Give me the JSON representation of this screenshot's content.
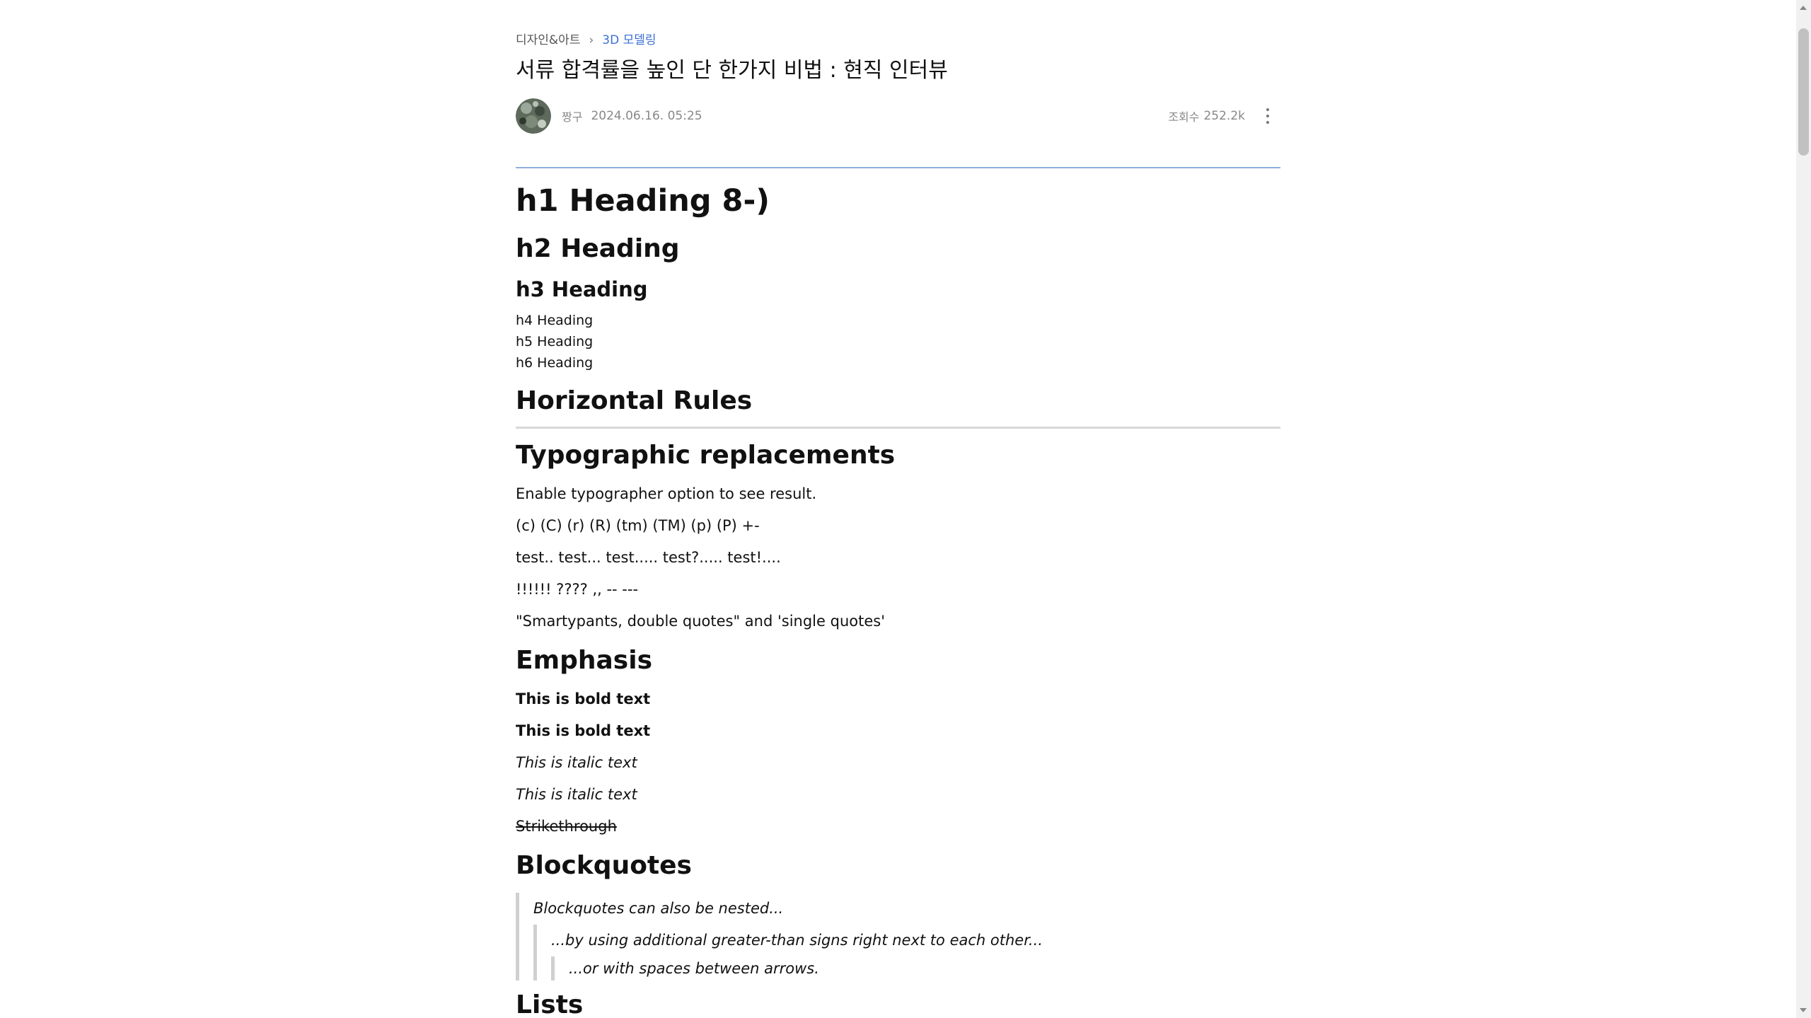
{
  "breadcrumb": {
    "category": "디자인&아트",
    "separator_icon": "chevron-right-icon",
    "subcategory": "3D 모델링"
  },
  "post": {
    "title": "서류 합격률을 높인 단 한가지 비법 : 현직 인터뷰",
    "author": "짱구",
    "date": "2024.06.16. 05:25",
    "views_label": "조회수",
    "views_value": "252.2k",
    "more_icon": "kebab-menu-icon"
  },
  "markdown": {
    "h1": "h1 Heading 8-)",
    "h2": "h2 Heading",
    "h3": "h3 Heading",
    "h4": "h4 Heading",
    "h5": "h5 Heading",
    "h6": "h6 Heading",
    "horizontal_rules": "Horizontal Rules",
    "typographic": {
      "heading": "Typographic replacements",
      "lines": [
        "Enable typographer option to see result.",
        "(c) (C) (r) (R) (tm) (TM) (p) (P) +-",
        "test.. test... test..... test?..... test!....",
        "!!!!!! ???? ,, -- ---",
        "\"Smartypants, double quotes\" and 'single quotes'"
      ]
    },
    "emphasis": {
      "heading": "Emphasis",
      "bold_1": "This is bold text",
      "bold_2": "This is bold text",
      "italic_1": "This is italic text",
      "italic_2": "This is italic text",
      "strike": "Strikethrough"
    },
    "blockquotes": {
      "heading": "Blockquotes",
      "level_1": "Blockquotes can also be nested...",
      "level_2": "...by using additional greater-than signs right next to each other...",
      "level_3": "...or with spaces between arrows."
    },
    "lists_heading": "Lists"
  },
  "colors": {
    "link": "#3b6fd4",
    "divider_accent": "#8fb0dc",
    "muted_text": "#888888"
  }
}
